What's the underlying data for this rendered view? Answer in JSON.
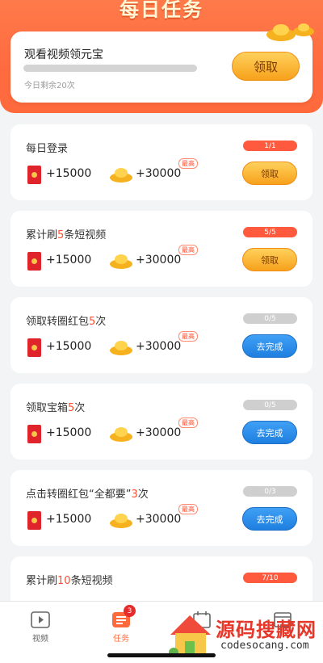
{
  "header": {
    "title": "每日任务"
  },
  "hero": {
    "title": "观看视频领元宝",
    "remaining": "今日剩余20次",
    "progress": 0,
    "button": "领取"
  },
  "tasks": [
    {
      "title_parts": [
        "每日登录",
        "",
        ""
      ],
      "redpacket": "+15000",
      "ingot": "+30000",
      "max": "最高",
      "progress": "1/1",
      "state": "done",
      "button": "领取"
    },
    {
      "title_parts": [
        "累计刷",
        "5",
        "条短视频"
      ],
      "redpacket": "+15000",
      "ingot": "+30000",
      "max": "最高",
      "progress": "5/5",
      "state": "done",
      "button": "领取"
    },
    {
      "title_parts": [
        "领取转圈红包",
        "5",
        "次"
      ],
      "redpacket": "+15000",
      "ingot": "+30000",
      "max": "最高",
      "progress": "0/5",
      "state": "todo",
      "button": "去完成"
    },
    {
      "title_parts": [
        "领取宝箱",
        "5",
        "次"
      ],
      "redpacket": "+15000",
      "ingot": "+30000",
      "max": "最高",
      "progress": "0/5",
      "state": "todo",
      "button": "去完成"
    },
    {
      "title_parts": [
        "点击转圈红包“全都要”",
        "3",
        "次"
      ],
      "redpacket": "+15000",
      "ingot": "+30000",
      "max": "最高",
      "progress": "0/3",
      "state": "todo",
      "button": "去完成"
    },
    {
      "title_parts": [
        "累计刷",
        "10",
        "条短视频"
      ],
      "redpacket": "",
      "ingot": "",
      "max": "",
      "progress": "7/10",
      "state": "done",
      "button": ""
    }
  ],
  "tabbar": {
    "items": [
      {
        "label": "视频",
        "icon": "play-icon",
        "active": false
      },
      {
        "label": "任务",
        "icon": "task-icon",
        "active": true,
        "badge": "3"
      },
      {
        "label": "",
        "icon": "calendar-icon",
        "active": false
      },
      {
        "label": "",
        "icon": "wallet-icon",
        "active": false
      }
    ]
  },
  "watermark": {
    "title": "源码搜藏网",
    "subtitle": "codesocang.com"
  },
  "colors": {
    "accent": "#ff6a3d",
    "claim": "#f7a11b",
    "go": "#1f7fe0",
    "progress_done": "#ff5a3d",
    "progress_todo": "#cfcfcf"
  }
}
